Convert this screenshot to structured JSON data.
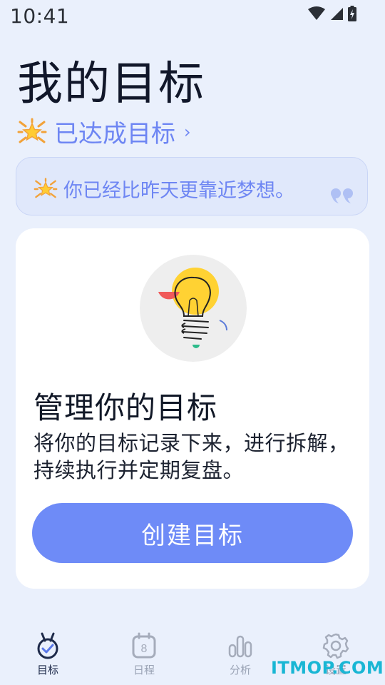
{
  "status_bar": {
    "time": "10:41"
  },
  "page": {
    "title": "我的目标"
  },
  "achieved": {
    "label": "已达成目标",
    "chevron": "›"
  },
  "quote": {
    "text": "你已经比昨天更靠近梦想。"
  },
  "card": {
    "title": "管理你的目标",
    "description": "将你的目标记录下来，进行拆解，持续执行并定期复盘。",
    "button_label": "创建目标"
  },
  "nav": {
    "items": [
      {
        "label": "目标",
        "icon": "medal-check-icon"
      },
      {
        "label": "日程",
        "icon": "calendar-icon",
        "badge": "8"
      },
      {
        "label": "分析",
        "icon": "bar-chart-icon"
      },
      {
        "label": "设置",
        "icon": "gear-icon"
      }
    ]
  },
  "watermark": {
    "text": "ITMOP.COM"
  },
  "colors": {
    "accent": "#6E8BF7",
    "background": "#EAF0FC",
    "text_accent": "#6E86F3",
    "watermark": "#19B6D4"
  }
}
